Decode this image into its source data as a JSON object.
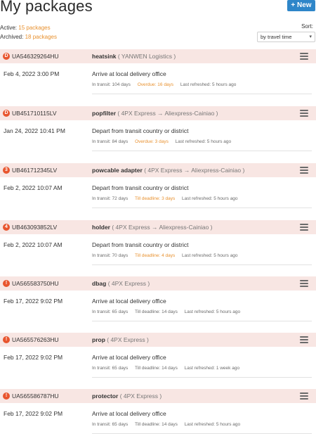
{
  "header": {
    "title": "My packages",
    "new_button": "+ New"
  },
  "summary": {
    "active_label": "Active:",
    "active_value": "15 packages",
    "archived_label": "Archived:",
    "archived_value": "18 packages"
  },
  "sort": {
    "label": "Sort:",
    "selected": "by travel time"
  },
  "colors": {
    "accent_button": "#2e86c9",
    "warning_text": "#e8912f",
    "row_header_bg": "#f8e6e3",
    "badge_bg": "#e8552e"
  },
  "packages": [
    {
      "badge": "D",
      "tracking": "UA546329264HU",
      "name": "heatsink",
      "carrier": "( YANWEN Logistics )",
      "date": "Feb 4, 2022 3:00 PM",
      "status": "Arrive at local delivery office",
      "transit": "In transit: 104 days",
      "deadline": "Overdue: 16 days",
      "deadline_warn": true,
      "refreshed": "Last refreshed: 5 hours ago"
    },
    {
      "badge": "D",
      "tracking": "UB451710115LV",
      "name": "popfilter",
      "carrier": "( 4PX Express → Aliexpress-Cainiao )",
      "date": "Jan 24, 2022 10:41 PM",
      "status": "Depart from transit country or district",
      "transit": "In transit: 84 days",
      "deadline": "Overdue: 3 days",
      "deadline_warn": true,
      "refreshed": "Last refreshed: 5 hours ago"
    },
    {
      "badge": "3",
      "tracking": "UB461712345LV",
      "name": "powcable adapter",
      "carrier": "( 4PX Express → Aliexpress-Cainiao )",
      "date": "Feb 2, 2022 10:07 AM",
      "status": "Depart from transit country or district",
      "transit": "In transit: 72 days",
      "deadline": "Till deadline: 3 days",
      "deadline_warn": true,
      "refreshed": "Last refreshed: 5 hours ago"
    },
    {
      "badge": "4",
      "tracking": "UB463093852LV",
      "name": "holder",
      "carrier": "( 4PX Express → Aliexpress-Cainiao )",
      "date": "Feb 2, 2022 10:07 AM",
      "status": "Depart from transit country or district",
      "transit": "In transit: 70 days",
      "deadline": "Till deadline: 4 days",
      "deadline_warn": true,
      "refreshed": "Last refreshed: 5 hours ago"
    },
    {
      "badge": "!",
      "tracking": "UA565583750HU",
      "name": "dbag",
      "carrier": "( 4PX Express )",
      "date": "Feb 17, 2022 9:02 PM",
      "status": "Arrive at local delivery office",
      "transit": "In transit: 65 days",
      "deadline": "Till deadline: 14 days",
      "deadline_warn": false,
      "refreshed": "Last refreshed: 5 hours ago"
    },
    {
      "badge": "!",
      "tracking": "UA565576263HU",
      "name": "prop",
      "carrier": "( 4PX Express )",
      "date": "Feb 17, 2022 9:02 PM",
      "status": "Arrive at local delivery office",
      "transit": "In transit: 65 days",
      "deadline": "Till deadline: 14 days",
      "deadline_warn": false,
      "refreshed": "Last refreshed: 1 week ago"
    },
    {
      "badge": "!",
      "tracking": "UA565586787HU",
      "name": "protector",
      "carrier": "( 4PX Express )",
      "date": "Feb 17, 2022 9:02 PM",
      "status": "Arrive at local delivery office",
      "transit": "In transit: 65 days",
      "deadline": "Till deadline: 14 days",
      "deadline_warn": false,
      "refreshed": "Last refreshed: 5 hours ago"
    }
  ]
}
